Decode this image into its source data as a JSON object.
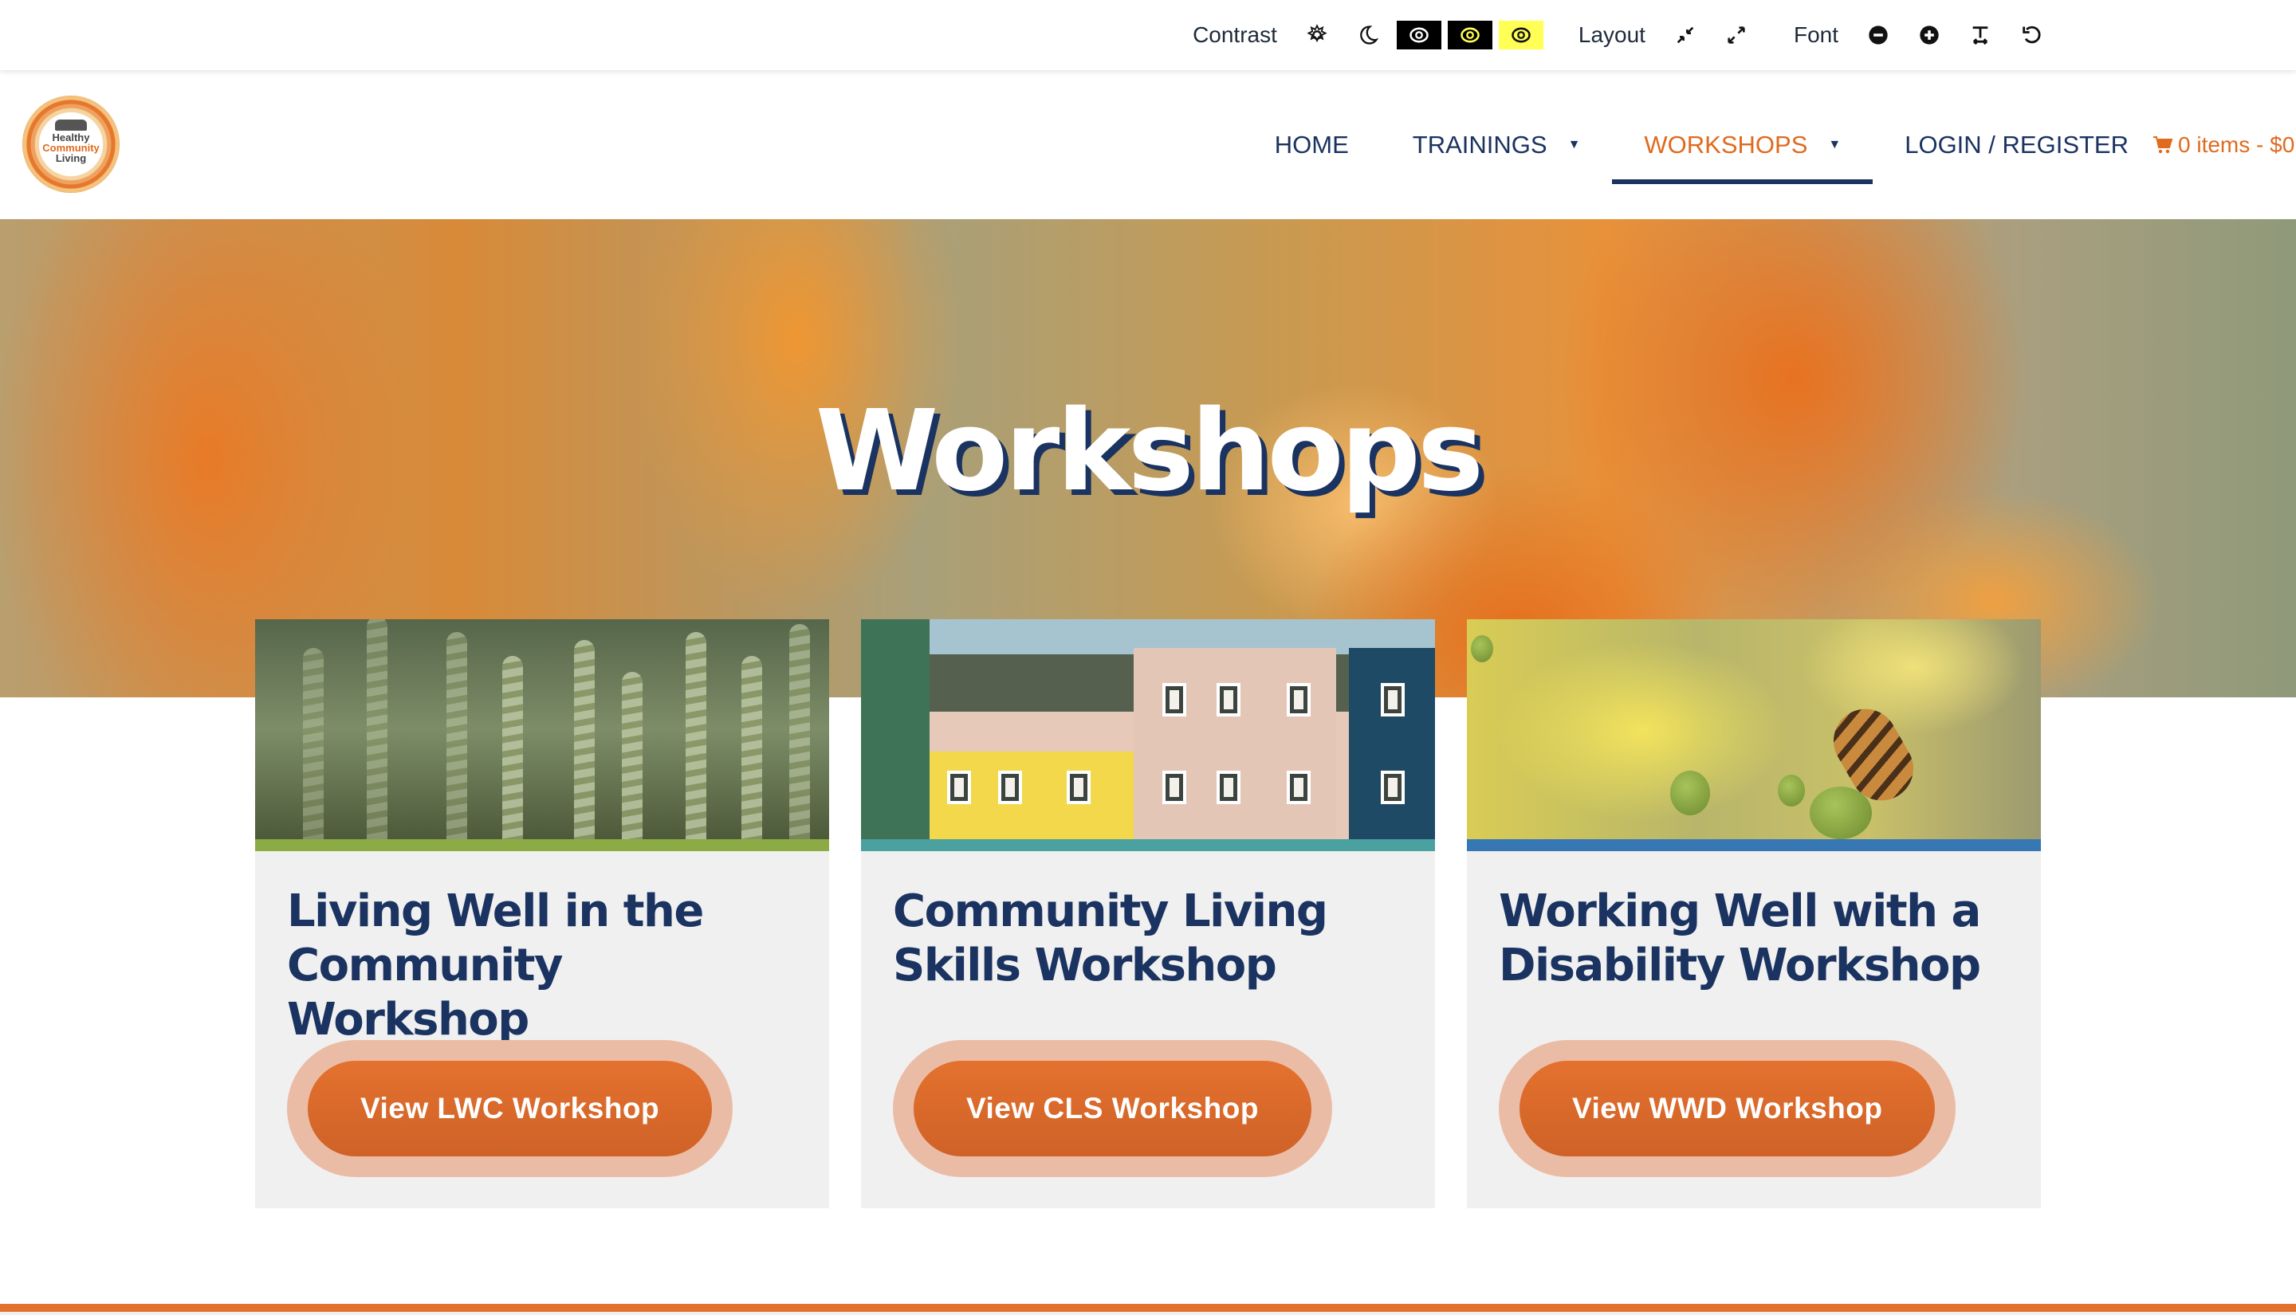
{
  "accessibility_toolbar": {
    "contrast_label": "Contrast",
    "contrast_options": [
      {
        "name": "light-mode",
        "icon": "sun-gear-icon"
      },
      {
        "name": "dark-mode",
        "icon": "moon-icon"
      },
      {
        "name": "high-contrast-white-on-black",
        "icon": "eye-icon"
      },
      {
        "name": "high-contrast-yellow-on-black",
        "icon": "eye-icon"
      },
      {
        "name": "high-contrast-black-on-yellow",
        "icon": "eye-icon"
      }
    ],
    "layout_label": "Layout",
    "layout_options": [
      {
        "name": "compress-layout",
        "icon": "compress-arrows-icon"
      },
      {
        "name": "expand-layout",
        "icon": "expand-arrows-icon"
      }
    ],
    "font_label": "Font",
    "font_options": [
      {
        "name": "decrease-font",
        "icon": "minus-circle-icon"
      },
      {
        "name": "increase-font",
        "icon": "plus-circle-icon"
      },
      {
        "name": "text-spacing",
        "icon": "text-height-icon"
      },
      {
        "name": "reset",
        "icon": "undo-icon"
      }
    ]
  },
  "header": {
    "logo": {
      "line1": "Healthy",
      "line2": "Community",
      "line3": "Living"
    },
    "nav": [
      {
        "label": "HOME",
        "has_dropdown": false,
        "active": false
      },
      {
        "label": "TRAININGS",
        "has_dropdown": true,
        "active": false
      },
      {
        "label": "WORKSHOPS",
        "has_dropdown": true,
        "active": true
      },
      {
        "label": "LOGIN / REGISTER",
        "has_dropdown": false,
        "active": false
      }
    ],
    "dropdown_caret": "▼",
    "cart": {
      "icon": "shopping-cart-icon",
      "text": "0 items - $0"
    }
  },
  "hero": {
    "title": "Workshops"
  },
  "cards": [
    {
      "title": "Living Well in the Community Workshop",
      "button_label": "View LWC Workshop",
      "image": "wheat-field-photo",
      "accent_color": "#8cab44"
    },
    {
      "title": "Community Living Skills Workshop",
      "button_label": "View CLS Workshop",
      "image": "row-houses-photo",
      "accent_color": "#4ba0a0"
    },
    {
      "title": "Working Well with a Disability Workshop",
      "button_label": "View WWD Workshop",
      "image": "bee-flower-photo",
      "accent_color": "#3677b4"
    }
  ],
  "colors": {
    "brand_orange": "#e06a1e",
    "navy": "#1b3360",
    "button_orange": "#d86829",
    "button_halo": "#ebbca5",
    "card_bg": "#f0f0f0"
  }
}
